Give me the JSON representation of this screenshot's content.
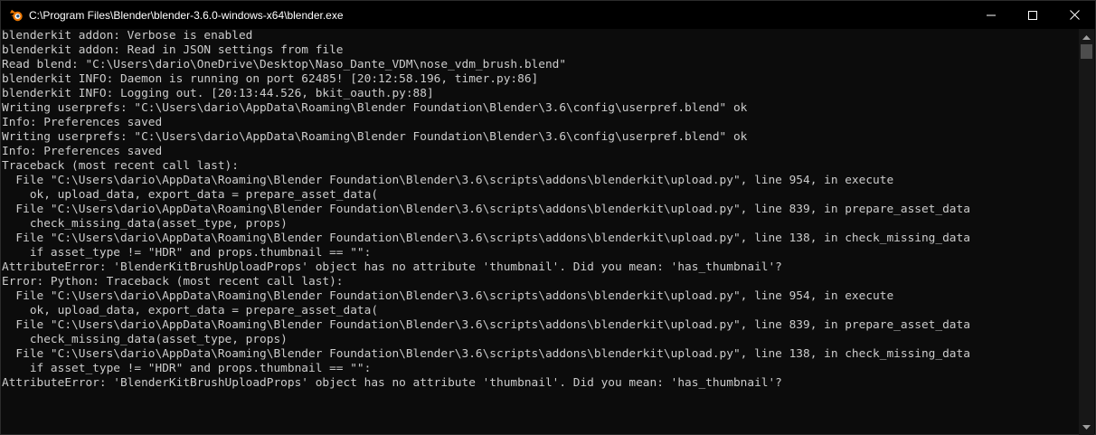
{
  "window": {
    "title": "C:\\Program Files\\Blender\\blender-3.6.0-windows-x64\\blender.exe",
    "app_icon": "blender-logo-icon",
    "colors": {
      "titlebar": "#000000",
      "console_bg": "#0c0c0c",
      "console_text": "#cccccc",
      "icon_orange": "#ea7600",
      "icon_blue": "#265787"
    }
  },
  "controls": {
    "minimize_icon": "minimize-icon",
    "maximize_icon": "maximize-icon",
    "close_icon": "close-icon"
  },
  "console": {
    "lines": [
      "blenderkit addon: Verbose is enabled",
      "blenderkit addon: Read in JSON settings from file",
      "Read blend: \"C:\\Users\\dario\\OneDrive\\Desktop\\Naso_Dante_VDM\\nose_vdm_brush.blend\"",
      "blenderkit INFO: Daemon is running on port 62485! [20:12:58.196, timer.py:86]",
      "blenderkit INFO: Logging out. [20:13:44.526, bkit_oauth.py:88]",
      "Writing userprefs: \"C:\\Users\\dario\\AppData\\Roaming\\Blender Foundation\\Blender\\3.6\\config\\userpref.blend\" ok",
      "Info: Preferences saved",
      "Writing userprefs: \"C:\\Users\\dario\\AppData\\Roaming\\Blender Foundation\\Blender\\3.6\\config\\userpref.blend\" ok",
      "Info: Preferences saved",
      "Traceback (most recent call last):",
      "  File \"C:\\Users\\dario\\AppData\\Roaming\\Blender Foundation\\Blender\\3.6\\scripts\\addons\\blenderkit\\upload.py\", line 954, in execute",
      "    ok, upload_data, export_data = prepare_asset_data(",
      "  File \"C:\\Users\\dario\\AppData\\Roaming\\Blender Foundation\\Blender\\3.6\\scripts\\addons\\blenderkit\\upload.py\", line 839, in prepare_asset_data",
      "    check_missing_data(asset_type, props)",
      "  File \"C:\\Users\\dario\\AppData\\Roaming\\Blender Foundation\\Blender\\3.6\\scripts\\addons\\blenderkit\\upload.py\", line 138, in check_missing_data",
      "    if asset_type != \"HDR\" and props.thumbnail == \"\":",
      "AttributeError: 'BlenderKitBrushUploadProps' object has no attribute 'thumbnail'. Did you mean: 'has_thumbnail'?",
      "Error: Python: Traceback (most recent call last):",
      "  File \"C:\\Users\\dario\\AppData\\Roaming\\Blender Foundation\\Blender\\3.6\\scripts\\addons\\blenderkit\\upload.py\", line 954, in execute",
      "    ok, upload_data, export_data = prepare_asset_data(",
      "  File \"C:\\Users\\dario\\AppData\\Roaming\\Blender Foundation\\Blender\\3.6\\scripts\\addons\\blenderkit\\upload.py\", line 839, in prepare_asset_data",
      "    check_missing_data(asset_type, props)",
      "  File \"C:\\Users\\dario\\AppData\\Roaming\\Blender Foundation\\Blender\\3.6\\scripts\\addons\\blenderkit\\upload.py\", line 138, in check_missing_data",
      "    if asset_type != \"HDR\" and props.thumbnail == \"\":",
      "AttributeError: 'BlenderKitBrushUploadProps' object has no attribute 'thumbnail'. Did you mean: 'has_thumbnail'?"
    ]
  },
  "scrollbar": {
    "up_icon": "scroll-up-arrow-icon",
    "down_icon": "scroll-down-arrow-icon"
  }
}
